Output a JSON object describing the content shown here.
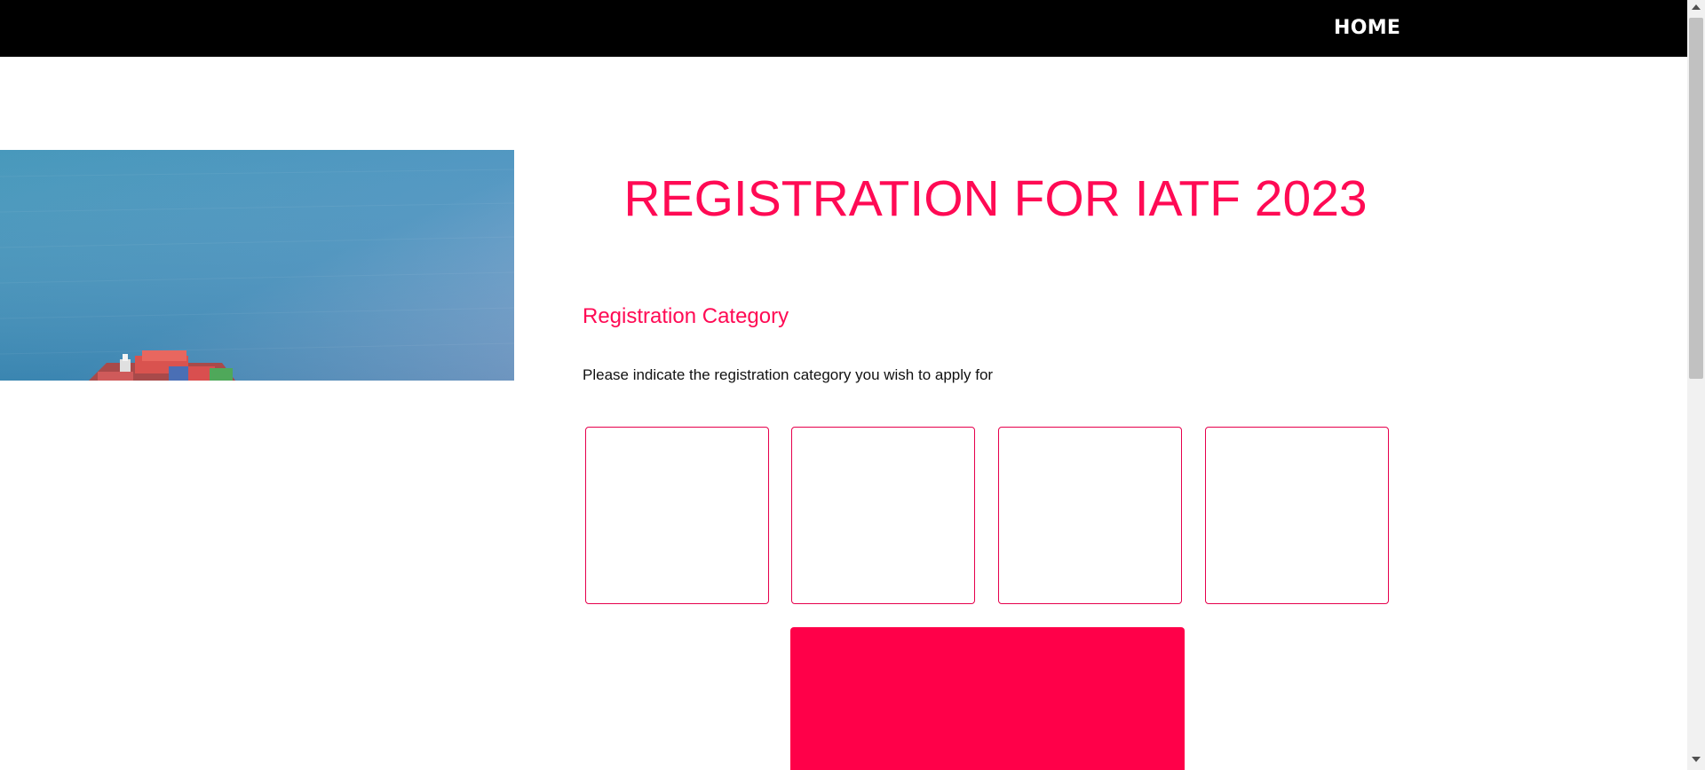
{
  "nav": {
    "home_label": "HOME"
  },
  "hero": {
    "image_icon": "cargo-ship-ocean-photo"
  },
  "page": {
    "title": "REGISTRATION FOR IATF 2023"
  },
  "registration": {
    "heading": "Registration Category",
    "instructions": "Please indicate the registration category you wish to apply for",
    "categories": [
      "",
      "",
      "",
      ""
    ]
  },
  "colors": {
    "accent": "#ff0a54",
    "card_border": "#e6004c",
    "submit_background": "#ff0049",
    "nav_background": "#000000",
    "nav_text": "#ffffff"
  }
}
